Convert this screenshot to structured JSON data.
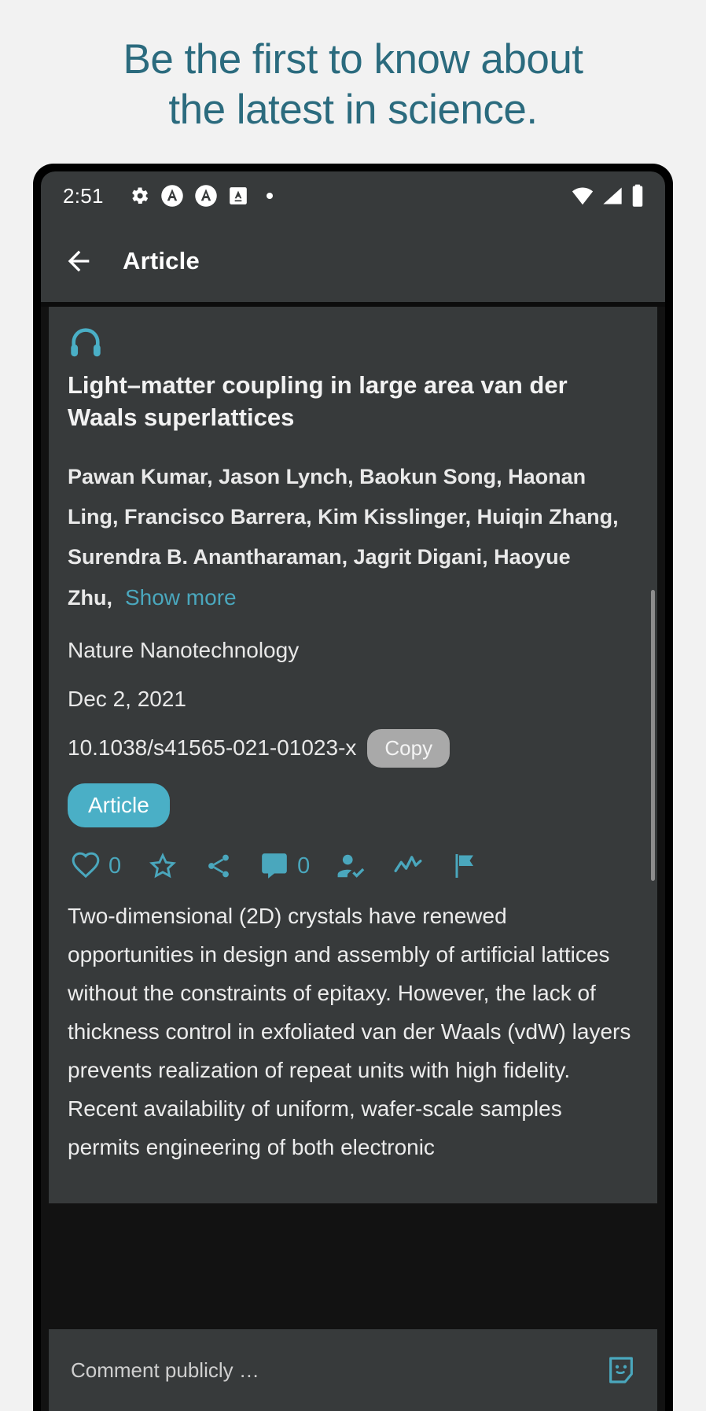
{
  "promo": {
    "line1": "Be the first to know about",
    "line2": "the latest in science.",
    "color": "#2b6b7e"
  },
  "status_bar": {
    "time": "2:51",
    "icons": [
      "gear-icon",
      "app-badge-a-icon",
      "app-badge-a-icon",
      "app-square-a-icon",
      "dot-icon"
    ],
    "right_icons": [
      "wifi-icon",
      "cellular-signal-icon",
      "battery-icon"
    ]
  },
  "app_bar": {
    "back_label": "back-arrow",
    "title": "Article"
  },
  "article": {
    "audio_icon": "headphones-icon",
    "title": "Light–matter coupling in large area van der Waals superlattices",
    "authors": "Pawan Kumar, Jason Lynch, Baokun Song, Haonan Ling, Francisco Barrera, Kim Kisslinger, Huiqin Zhang, Surendra B. Anantharaman, Jagrit Digani, Haoyue Zhu,",
    "show_more": "Show more",
    "journal": "Nature Nanotechnology",
    "date": "Dec 2, 2021",
    "doi": "10.1038/s41565-021-01023-x",
    "copy_label": "Copy",
    "type_chip": "Article",
    "abstract": "Two-dimensional (2D) crystals have renewed opportunities in design and assembly of artificial lattices without the constraints of epitaxy. However, the lack of thickness control in exfoliated van der Waals (vdW) layers prevents realization of repeat units with high fidelity. Recent availability of uniform, wafer-scale samples permits engineering of both electronic",
    "accent_color": "#4aafc6",
    "link_color": "#4aa7bd"
  },
  "actions": [
    {
      "name": "like-button",
      "icon": "heart-icon",
      "count": "0"
    },
    {
      "name": "bookmark-button",
      "icon": "star-icon",
      "count": ""
    },
    {
      "name": "share-button",
      "icon": "share-icon",
      "count": ""
    },
    {
      "name": "comment-button",
      "icon": "comment-bubble-icon",
      "count": "0"
    },
    {
      "name": "follow-author-button",
      "icon": "person-check-icon",
      "count": ""
    },
    {
      "name": "stats-button",
      "icon": "trend-line-icon",
      "count": ""
    },
    {
      "name": "flag-button",
      "icon": "flag-icon",
      "count": ""
    }
  ],
  "comment_bar": {
    "placeholder": "Comment publicly …",
    "emoji_icon": "sticker-emoji-icon"
  }
}
